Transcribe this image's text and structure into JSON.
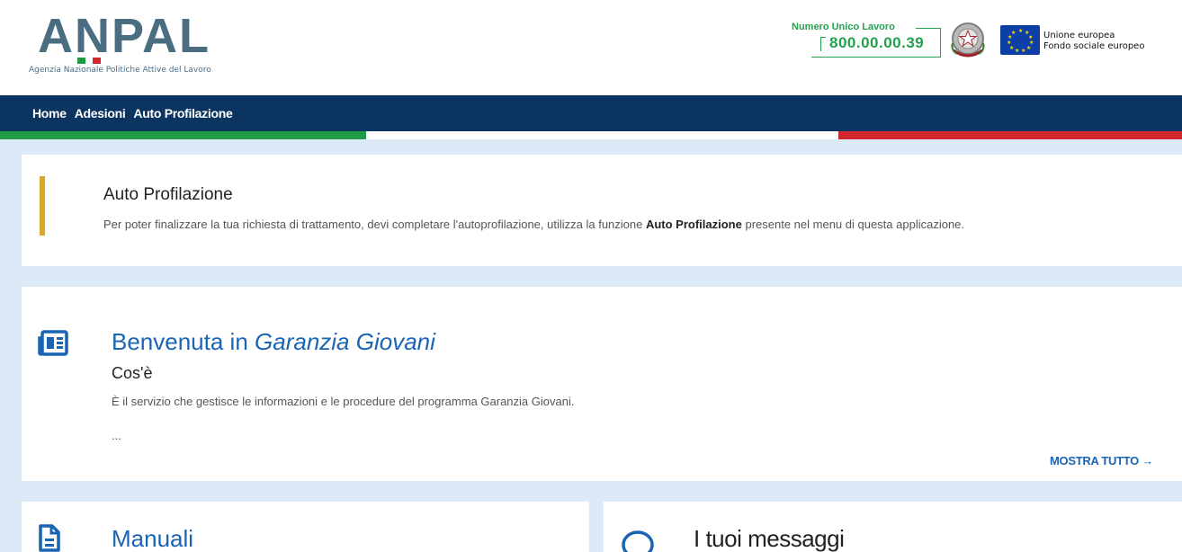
{
  "header": {
    "logo_text": "ANPAL",
    "logo_subtitle": "Agenzia Nazionale Politiche Attive del Lavoro",
    "helpline_label": "Numero Unico Lavoro",
    "helpline_number": "800.00.00.39",
    "eu_line1": "Unione europea",
    "eu_line2": "Fondo sociale europeo",
    "flag_colors": [
      "#1f9a45",
      "#ffffff",
      "#d0282e"
    ]
  },
  "navbar": {
    "items": [
      {
        "label": "Home"
      },
      {
        "label": "Adesioni"
      },
      {
        "label": "Auto Profilazione"
      }
    ]
  },
  "alert": {
    "title": "Auto Profilazione",
    "text_before": "Per poter finalizzare la tua richiesta di trattamento, devi completare l'autoprofilazione, utilizza la funzione ",
    "text_bold": "Auto Profilazione",
    "text_after": " presente nel menu di questa applicazione."
  },
  "welcome": {
    "title_prefix": "Benvenuta in ",
    "title_italic": "Garanzia Giovani",
    "subtitle": "Cos'è",
    "description": "È il servizio che gestisce le informazioni e le procedure del programma Garanzia Giovani.",
    "ellipsis": "...",
    "show_all": "MOSTRA TUTTO →"
  },
  "manuali": {
    "title": "Manuali"
  },
  "messages": {
    "title": "I tuoi messaggi"
  },
  "colors": {
    "navbar": "#0c3461",
    "accent_blue": "#1a64b4",
    "helpline_green": "#21a24d",
    "alert_bar": "#d8a82b",
    "background": "#dce9f7"
  }
}
